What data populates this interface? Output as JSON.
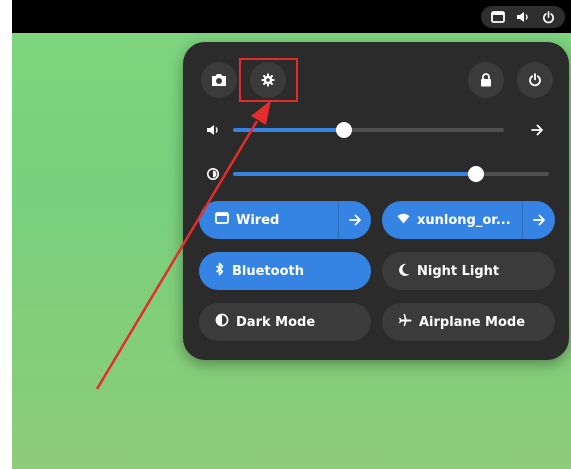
{
  "top_bar": {
    "status_icons": [
      "network-icon",
      "volume-icon",
      "power-icon"
    ]
  },
  "quick_settings": {
    "top_buttons": {
      "left": [
        "screenshot-icon",
        "settings-icon"
      ],
      "right": [
        "lock-icon",
        "power-icon"
      ]
    },
    "volume_slider": {
      "icon": "volume-icon",
      "level": 0.41
    },
    "brightness_slider": {
      "icon": "brightness-icon",
      "level": 0.77
    },
    "toggles": [
      {
        "label": "Wired",
        "icon": "wired-network-icon",
        "active": true,
        "has_menu": true
      },
      {
        "label": "xunlong_or...",
        "icon": "wifi-icon",
        "active": true,
        "has_menu": true
      },
      {
        "label": "Bluetooth",
        "icon": "bluetooth-icon",
        "active": true,
        "has_menu": false
      },
      {
        "label": "Night Light",
        "icon": "moon-icon",
        "active": false,
        "has_menu": false
      },
      {
        "label": "Dark Mode",
        "icon": "dark-mode-icon",
        "active": false,
        "has_menu": false
      },
      {
        "label": "Airplane Mode",
        "icon": "airplane-icon",
        "active": false,
        "has_menu": false
      }
    ]
  },
  "colors": {
    "accent": "#3584e4",
    "panel": "#2b2b2b",
    "button": "#3b3b3b",
    "annotation": "#e52b2b",
    "desktop": "#7fd67e"
  }
}
